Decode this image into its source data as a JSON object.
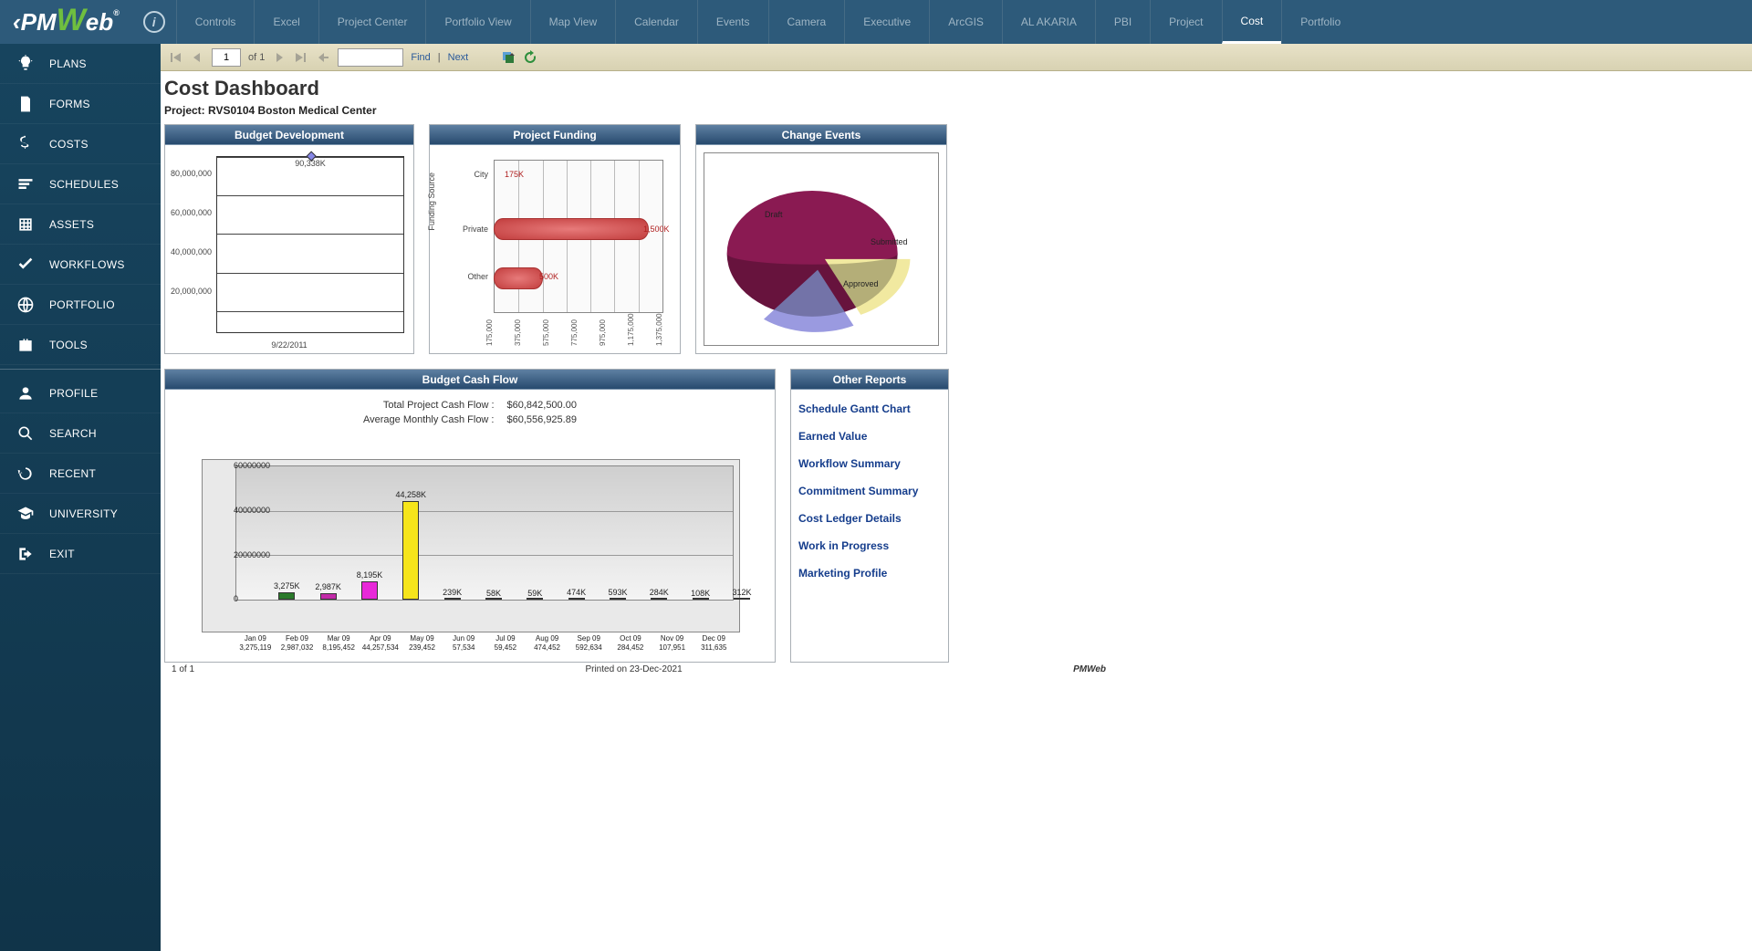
{
  "logo": {
    "pre": "‹PM",
    "w": "W",
    "post": "eb",
    "reg": "®"
  },
  "topnav": [
    "Controls",
    "Excel",
    "Project Center",
    "Portfolio View",
    "Map View",
    "Calendar",
    "Events",
    "Camera",
    "Executive",
    "ArcGIS",
    "AL AKARIA",
    "PBI",
    "Project",
    "Cost",
    "Portfolio"
  ],
  "topnav_active": 13,
  "sidebar": [
    {
      "label": "PLANS",
      "icon": "bulb"
    },
    {
      "label": "FORMS",
      "icon": "form"
    },
    {
      "label": "COSTS",
      "icon": "dollar"
    },
    {
      "label": "SCHEDULES",
      "icon": "bars"
    },
    {
      "label": "ASSETS",
      "icon": "grid"
    },
    {
      "label": "WORKFLOWS",
      "icon": "check"
    },
    {
      "label": "PORTFOLIO",
      "icon": "globe"
    },
    {
      "label": "TOOLS",
      "icon": "briefcase"
    }
  ],
  "sidebar2": [
    {
      "label": "PROFILE",
      "icon": "user"
    },
    {
      "label": "SEARCH",
      "icon": "search"
    },
    {
      "label": "RECENT",
      "icon": "history"
    },
    {
      "label": "UNIVERSITY",
      "icon": "grad"
    },
    {
      "label": "EXIT",
      "icon": "exit"
    }
  ],
  "toolbar": {
    "page_value": "1",
    "page_of": "of  1",
    "find": "Find",
    "next": "Next",
    "sep": "|"
  },
  "dash": {
    "title": "Cost Dashboard",
    "project_label": "Project: RVS0104 Boston Medical Center"
  },
  "panels": {
    "budget_dev": "Budget Development",
    "funding": "Project Funding",
    "change": "Change Events",
    "cashflow": "Budget Cash Flow",
    "other": "Other Reports"
  },
  "chart_data": [
    {
      "type": "bar",
      "panel": "budget_dev",
      "categories": [
        "9/22/2011"
      ],
      "values": [
        90338000
      ],
      "label": "90,338K",
      "ylabel": "",
      "ylim": [
        0,
        90000000
      ],
      "yticks": [
        20000000,
        40000000,
        60000000,
        80000000
      ],
      "ytick_labels": [
        "20,000,000",
        "40,000,000",
        "60,000,000",
        "80,000,000"
      ]
    },
    {
      "type": "bar",
      "panel": "funding",
      "orientation": "h",
      "ylabel": "Funding Source",
      "categories": [
        "City",
        "Private",
        "Other"
      ],
      "values": [
        175000,
        1500000,
        500000
      ],
      "value_labels": [
        "175K",
        "1,500K",
        "500K"
      ],
      "xlim": [
        175000,
        1375000
      ],
      "xtick_labels": [
        "175,000",
        "375,000",
        "575,000",
        "775,000",
        "975,000",
        "1,175,000",
        "1,375,000"
      ]
    },
    {
      "type": "pie",
      "panel": "change",
      "series": [
        {
          "name": "Draft",
          "value": 60
        },
        {
          "name": "Submitted",
          "value": 12
        },
        {
          "name": "Approved",
          "value": 28
        }
      ]
    },
    {
      "type": "bar",
      "panel": "cashflow",
      "ylim": [
        0,
        60000000
      ],
      "yticks": [
        0,
        20000000,
        40000000,
        60000000
      ],
      "categories": [
        "Jan 09",
        "Feb 09",
        "Mar 09",
        "Apr 09",
        "May 09",
        "Jun 09",
        "Jul 09",
        "Aug 09",
        "Sep 09",
        "Oct 09",
        "Nov 09",
        "Dec 09"
      ],
      "values": [
        3275119,
        2987032,
        8195452,
        44257534,
        239452,
        57534,
        59452,
        474452,
        592634,
        284452,
        107951,
        311635
      ],
      "value_labels": [
        "3,275K",
        "2,987K",
        "8,195K",
        "44,258K",
        "239K",
        "58K",
        "59K",
        "474K",
        "593K",
        "284K",
        "108K",
        "312K"
      ],
      "row2_labels": [
        "3,275,119",
        "2,987,032",
        "8,195,452",
        "44,257,534",
        "239,452",
        "57,534",
        "59,452",
        "474,452",
        "592,634",
        "284,452",
        "107,951",
        "311,635"
      ],
      "colors": [
        "#2a7a2a",
        "#c22aa8",
        "#e828d9",
        "#f6e51b",
        "#2a7a2a",
        "#b02020",
        "#2a7a2a",
        "#b02020",
        "#2a7a2a",
        "#b02020",
        "#2a7a2a",
        "#d3c83a"
      ]
    }
  ],
  "cashflow_stats": {
    "total_label": "Total Project Cash Flow :",
    "total_value": "$60,842,500.00",
    "avg_label": "Average Monthly Cash Flow :",
    "avg_value": "$60,556,925.89"
  },
  "reports": [
    "Schedule Gantt Chart",
    "Earned Value",
    "Workflow Summary",
    "Commitment Summary",
    "Cost Ledger Details",
    "Work in Progress",
    "Marketing Profile"
  ],
  "footer": {
    "pages": "1 of 1",
    "printed": "Printed on 23-Dec-2021",
    "brand": "PMWeb"
  }
}
